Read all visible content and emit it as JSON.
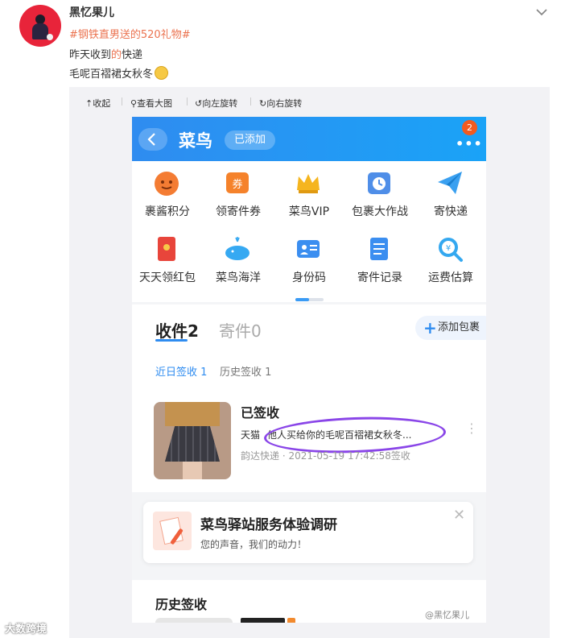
{
  "post": {
    "author": "黑忆果儿",
    "topic": "#钢铁直男送的520礼物#",
    "line2_a": "昨天收到",
    "line2_b": "的",
    "line2_c": "快递",
    "line3": "毛呢百褶裙女秋冬"
  },
  "image_toolbar": {
    "collapse": "收起",
    "view_large": "查看大图",
    "rotate_left": "向左旋转",
    "rotate_right": "向右旋转"
  },
  "app": {
    "title": "菜鸟",
    "added_label": "已添加",
    "more": "•••",
    "badge": "2",
    "grid": [
      {
        "label": "裹酱积分",
        "icon": "smiley-orange-icon",
        "color": "#f47c33"
      },
      {
        "label": "领寄件券",
        "icon": "coupon-icon",
        "color": "#f5822b"
      },
      {
        "label": "菜鸟VIP",
        "icon": "crown-icon",
        "color": "#f5b51f"
      },
      {
        "label": "包裹大作战",
        "icon": "clock-box-icon",
        "color": "#4f8ee8"
      },
      {
        "label": "寄快递",
        "icon": "paper-plane-icon",
        "color": "#3aa0f0"
      },
      {
        "label": "天天领红包",
        "icon": "red-envelope-icon",
        "color": "#e8453b"
      },
      {
        "label": "菜鸟海洋",
        "icon": "whale-icon",
        "color": "#36a9f2"
      },
      {
        "label": "身份码",
        "icon": "id-card-icon",
        "color": "#3b8ef0"
      },
      {
        "label": "寄件记录",
        "icon": "record-list-icon",
        "color": "#3b8ef0"
      },
      {
        "label": "运费估算",
        "icon": "yuan-search-icon",
        "color": "#34a8f0"
      }
    ],
    "tab_receive": "收件2",
    "tab_send": "寄件0",
    "add_package": "添加包裹",
    "add_icon": "+",
    "sub_recent": "近日签收 1",
    "sub_history": "历史签收 1",
    "card": {
      "status": "已签收",
      "shop": "天猫",
      "message": "他人买给你的毛呢百褶裙女秋冬...",
      "carrier": "韵达快递 · 2021-05-19 17:42:58签收",
      "kebab": "⋮"
    },
    "survey": {
      "title": "菜鸟驿站服务体验调研",
      "subtitle": "您的声音，我们的动力！",
      "close": "✕"
    },
    "history_title": "历史签收"
  },
  "watermarks": {
    "right": "@黑忆果儿",
    "left": "大数跨境"
  }
}
